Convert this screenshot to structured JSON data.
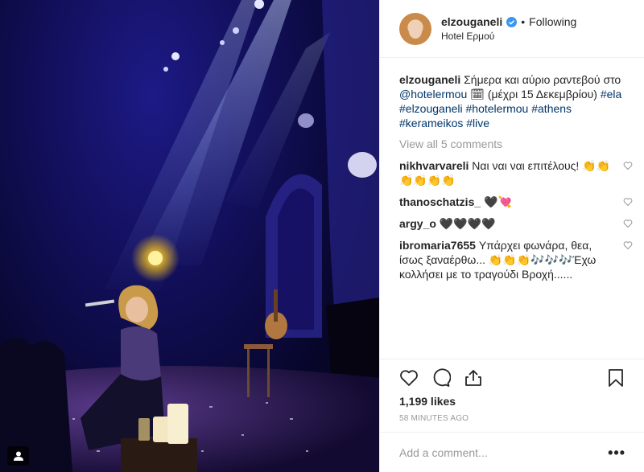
{
  "post": {
    "username": "elzouganeli",
    "separator": "•",
    "follow_state": "Following",
    "location": "Hotel Ερμού",
    "caption": {
      "text_start": "Σήμερα και αύριο ραντεβού στο",
      "mention": "@hotelermou",
      "text_end": "🗓 (μέχρι 15 Δεκεμβρίου)",
      "hashtags": [
        "#ela",
        "#elzouganeli",
        "#hotelermou",
        "#athens",
        "#kerameikos",
        "#live"
      ]
    },
    "view_all_comments": "View all 5 comments",
    "comments": [
      {
        "user": "nikhvarvareli",
        "text": "Ναι ναι ναι επιτέλους! 👏👏👏👏👏👏"
      },
      {
        "user": "thanoschatzis_",
        "text": "🖤💘"
      },
      {
        "user": "argy_o",
        "text": "🖤🖤🖤🖤"
      },
      {
        "user": "ibromaria7655",
        "text": "Υπάρχει φωνάρα, θεα, ίσως ξαναέρθω... 👏👏👏🎶🎶🎶Έχω κολλήσει με το τραγούδι Βροχή......"
      }
    ],
    "likes": "1,199 likes",
    "time": "58 MINUTES AGO",
    "add_comment_placeholder": "Add a comment...",
    "more": "•••"
  },
  "icons": {
    "like": "heart-icon",
    "comment": "comment-bubble-icon",
    "share": "share-icon",
    "save": "bookmark-icon",
    "verified": "verified-badge-icon",
    "comment_like": "heart-outline-icon",
    "tagged_user": "user-tag-icon"
  },
  "colors": {
    "link": "#003569",
    "verified": "#3897f0",
    "muted": "#999999",
    "text": "#262626"
  }
}
